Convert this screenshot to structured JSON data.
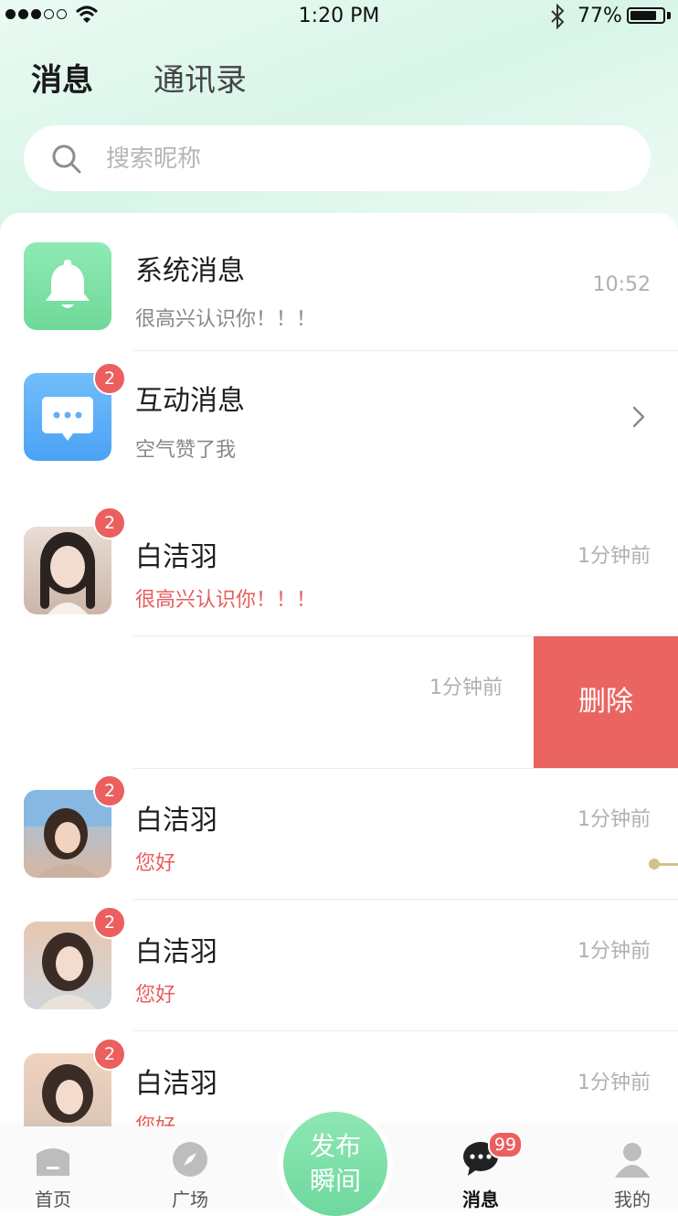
{
  "status_bar": {
    "time": "1:20 PM",
    "battery_percent": "77%",
    "signal_bars_filled": 3,
    "signal_bars_total": 5
  },
  "header": {
    "tabs": [
      {
        "label": "消息",
        "active": true
      },
      {
        "label": "通讯录",
        "active": false
      }
    ]
  },
  "search": {
    "placeholder": "搜索昵称",
    "value": ""
  },
  "conversations": [
    {
      "name": "系统消息",
      "message": "很高兴认识你！！！",
      "time": "10:52",
      "badge": "",
      "icon": "bell-icon"
    },
    {
      "name": "互动消息",
      "message": "空气赞了我",
      "time": "",
      "badge": "2",
      "icon": "chat-bubble-icon"
    },
    {
      "name": "白洁羽",
      "message": "很高兴认识你！！！",
      "time": "1分钟前",
      "badge": "2"
    },
    {
      "name": "",
      "message": "",
      "time": "1分钟前",
      "badge": ""
    },
    {
      "name": "白洁羽",
      "message": "您好",
      "time": "1分钟前",
      "badge": "2"
    },
    {
      "name": "白洁羽",
      "message": "您好",
      "time": "1分钟前",
      "badge": "2"
    },
    {
      "name": "白洁羽",
      "message": "您好",
      "time": "1分钟前",
      "badge": "2"
    }
  ],
  "swipe_action": {
    "delete_label": "删除"
  },
  "colors": {
    "accent_green": "#6ed89d",
    "badge_red": "#ec5f5f",
    "delete_red": "#ea6462",
    "system_icon_bg": "#7ee2a8",
    "interact_icon_bg": "#5eb0f7"
  },
  "tabbar": {
    "items": [
      {
        "label": "首页",
        "icon": "home-icon"
      },
      {
        "label": "广场",
        "icon": "compass-icon"
      },
      {
        "label": "消息",
        "icon": "message-icon",
        "active": true,
        "badge": "99"
      },
      {
        "label": "我的",
        "icon": "profile-icon"
      }
    ],
    "publish_line1": "发布",
    "publish_line2": "瞬间"
  }
}
